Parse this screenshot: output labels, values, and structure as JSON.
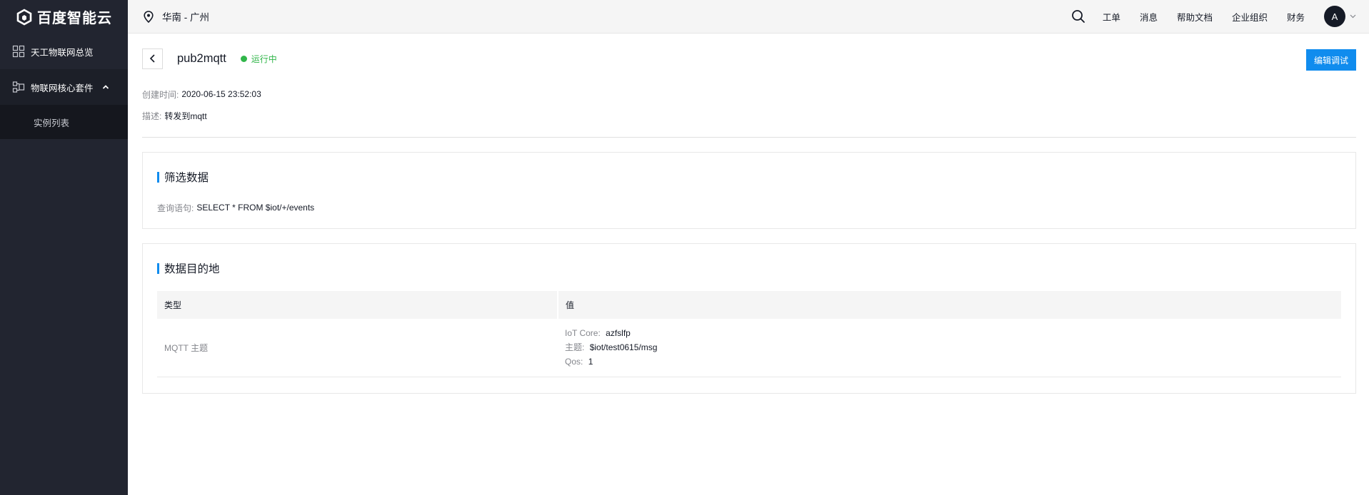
{
  "brand": {
    "name": "百度智能云"
  },
  "sidebar": {
    "items": [
      {
        "label": "天工物联网总览",
        "icon": "grid-icon"
      },
      {
        "label": "物联网核心套件",
        "icon": "iot-suite-icon",
        "expanded": true,
        "children": [
          {
            "label": "实例列表"
          }
        ]
      }
    ]
  },
  "topbar": {
    "region": "华南 - 广州",
    "links": [
      "工单",
      "消息",
      "帮助文档",
      "企业组织",
      "财务"
    ],
    "avatar": "A"
  },
  "detail": {
    "name": "pub2mqtt",
    "status": "运行中",
    "status_color": "#31b64a",
    "edit_label": "编辑调试",
    "created_label": "创建时间:",
    "created_value": "2020-06-15 23:52:03",
    "desc_label": "描述:",
    "desc_value": "转发到mqtt"
  },
  "filter": {
    "title": "筛选数据",
    "query_label": "查询语句:",
    "query_value": "SELECT * FROM $iot/+/events"
  },
  "destination": {
    "title": "数据目的地",
    "columns": [
      "类型",
      "值"
    ],
    "rows": [
      {
        "type": "MQTT 主题",
        "values": [
          {
            "key": "IoT Core:",
            "value": "azfslfp"
          },
          {
            "key": "主题:",
            "value": "$iot/test0615/msg"
          },
          {
            "key": "Qos:",
            "value": "1"
          }
        ]
      }
    ]
  },
  "colors": {
    "accent": "#108cee",
    "sidebar_bg": "#222530"
  }
}
